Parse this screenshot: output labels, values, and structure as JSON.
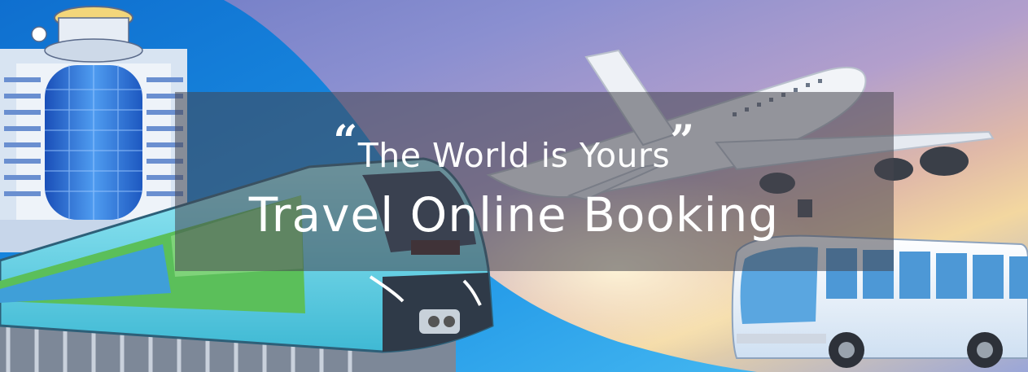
{
  "banner": {
    "open_quote": "“",
    "tagline": "The World is Yours",
    "close_quote": "”",
    "title": "Travel Online Booking"
  },
  "colors": {
    "sky_purple": "#8a8fd0",
    "wave_blue": "#1e8fe0",
    "building_blue": "#2f6fd6",
    "train_cyan": "#6fd8e8",
    "bus_white": "#eef4fb",
    "plane_white": "#f2f4f8"
  },
  "icons": {
    "building": "hotel-building-illustration",
    "train": "metro-train-illustration",
    "plane": "airplane-illustration",
    "bus": "bus-illustration"
  }
}
